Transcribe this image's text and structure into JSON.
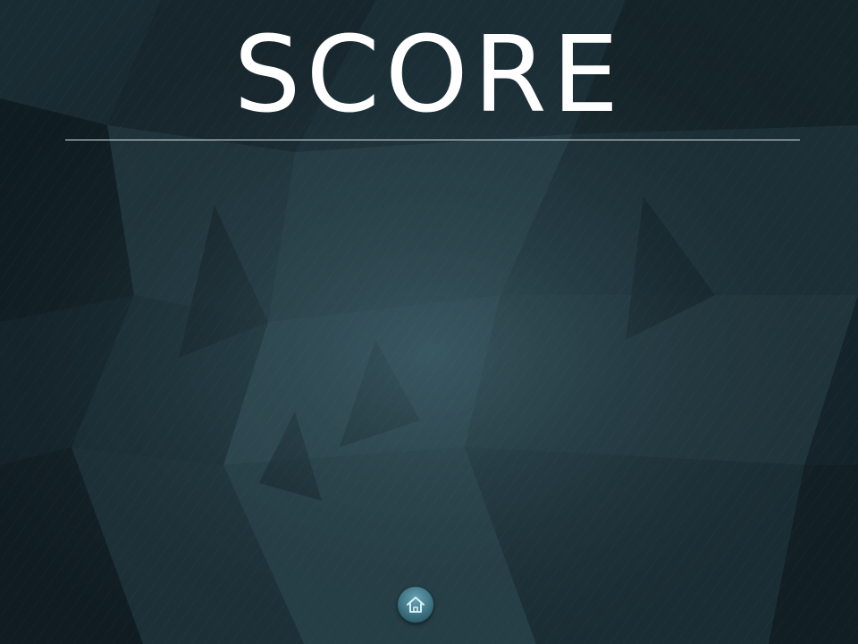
{
  "screen": {
    "title": "SCORE"
  },
  "controls": {
    "home_icon": "home-icon"
  },
  "colors": {
    "background": "#122026",
    "title": "#ffffff",
    "divider": "#d8e2e4",
    "home_button": "#3d7282"
  }
}
